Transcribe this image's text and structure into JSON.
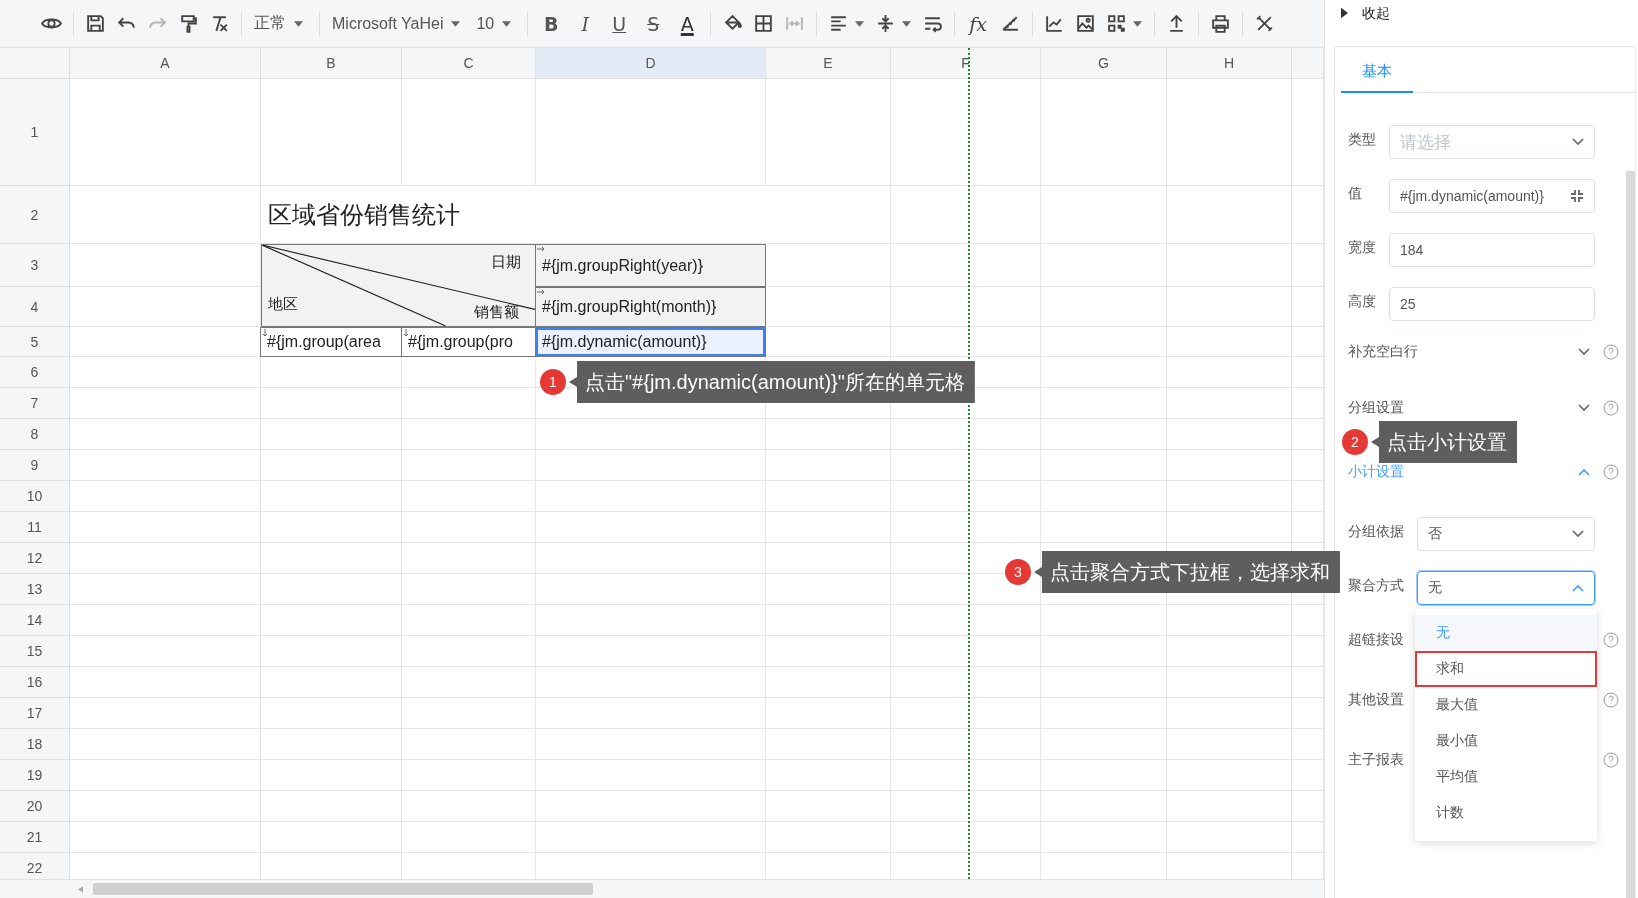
{
  "toolbar": {
    "style": "正常",
    "font": "Microsoft YaHei",
    "size": "10",
    "format": [
      {
        "kind": "bold",
        "text": "B"
      },
      {
        "kind": "italic",
        "text": "I"
      },
      {
        "kind": "underline",
        "text": "U"
      },
      {
        "kind": "strike",
        "text": "S"
      },
      {
        "kind": "color",
        "text": "A"
      }
    ],
    "formula": "fx"
  },
  "sheet": {
    "columns": [
      {
        "label": "A",
        "selected": false
      },
      {
        "label": "B",
        "selected": false
      },
      {
        "label": "C",
        "selected": false
      },
      {
        "label": "D",
        "selected": true
      },
      {
        "label": "E",
        "selected": false
      },
      {
        "label": "F",
        "selected": false
      },
      {
        "label": "G",
        "selected": false
      },
      {
        "label": "H",
        "selected": false
      }
    ],
    "rows": [
      "1",
      "2",
      "3",
      "4",
      "5",
      "6",
      "7",
      "8",
      "9",
      "10",
      "11",
      "12",
      "13",
      "14",
      "15",
      "16",
      "17",
      "18",
      "19",
      "20",
      "21",
      "22"
    ],
    "report": {
      "title": "区域省份销售统计",
      "corner": {
        "top": "日期",
        "bottom": "销售额",
        "left": "地区"
      },
      "column_groups": [
        {
          "text": "#{jm.groupRight(year)}",
          "kind": "expand-right"
        },
        {
          "text": "#{jm.groupRight(month)}",
          "kind": "expand-right"
        }
      ],
      "data_row": [
        {
          "text": "#{jm.group(area",
          "kind": "expand-down",
          "selected": false
        },
        {
          "text": "#{jm.group(pro",
          "kind": "expand-down",
          "selected": false
        },
        {
          "text": "#{jm.dynamic(amount)}",
          "kind": "plain",
          "selected": true
        }
      ]
    }
  },
  "callouts": [
    {
      "number": "1",
      "text": "点击\"#{jm.dynamic(amount)}\"所在的单元格"
    },
    {
      "number": "2",
      "text": "点击小计设置"
    },
    {
      "number": "3",
      "text": "点击聚合方式下拉框，选择求和"
    }
  ],
  "panel": {
    "collapse": "收起",
    "tabs": [
      {
        "label": "基本",
        "selected": true
      }
    ],
    "fields": [
      {
        "kind": "select",
        "label": "类型",
        "placeholder": "请选择"
      },
      {
        "kind": "input",
        "label": "值",
        "value": "#{jm.dynamic(amount)}",
        "collapse_button": true
      },
      {
        "kind": "input",
        "label": "宽度",
        "value": "184"
      },
      {
        "kind": "input",
        "label": "高度",
        "value": "25"
      },
      {
        "kind": "section",
        "label": "补充空白行",
        "expanded": false
      },
      {
        "kind": "section",
        "label": "分组设置",
        "expanded": false
      },
      {
        "kind": "section",
        "label": "小计设置",
        "expanded": true
      },
      {
        "kind": "select",
        "label": "分组依据",
        "value": "否"
      },
      {
        "kind": "select",
        "label": "聚合方式",
        "value": "无",
        "open": true,
        "options": [
          {
            "label": "无",
            "selected": true,
            "highlighted": false
          },
          {
            "label": "求和",
            "selected": false,
            "highlighted": true
          },
          {
            "label": "最大值",
            "selected": false,
            "highlighted": false
          },
          {
            "label": "最小值",
            "selected": false,
            "highlighted": false
          },
          {
            "label": "平均值",
            "selected": false,
            "highlighted": false
          },
          {
            "label": "计数",
            "selected": false,
            "highlighted": false
          }
        ]
      },
      {
        "kind": "section",
        "label": "超链接设"
      },
      {
        "kind": "section",
        "label": "其他设置"
      },
      {
        "kind": "section",
        "label": "主子报表"
      }
    ]
  }
}
